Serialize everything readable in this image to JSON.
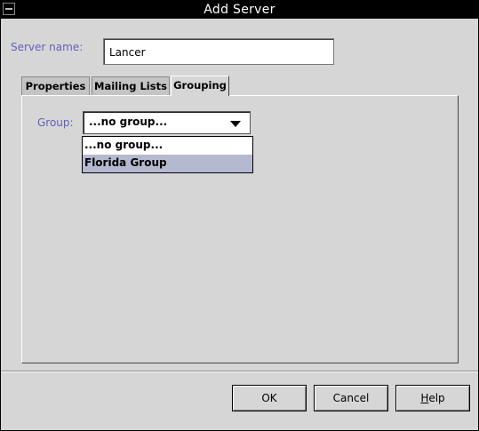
{
  "window": {
    "title": "Add Server"
  },
  "server": {
    "label": "Server name:",
    "value": "Lancer"
  },
  "tabs": [
    {
      "label": "Properties"
    },
    {
      "label": "Mailing Lists"
    },
    {
      "label": "Grouping",
      "active": true
    }
  ],
  "group": {
    "label": "Group:",
    "selected": "...no group...",
    "options": [
      "...no group...",
      "Florida Group"
    ],
    "highlighted_option": "Florida Group"
  },
  "buttons": {
    "ok": "OK",
    "cancel": "Cancel",
    "help_mnemonic": "H",
    "help_rest": "elp"
  },
  "colors": {
    "label_blue": "#6262b8",
    "highlight": "#b5b9cf",
    "titlebar": "#000000",
    "background": "#d6d6d6"
  },
  "icons": {
    "window_menu": "window-menu-icon",
    "combo_arrow": "triangle-down-icon"
  }
}
